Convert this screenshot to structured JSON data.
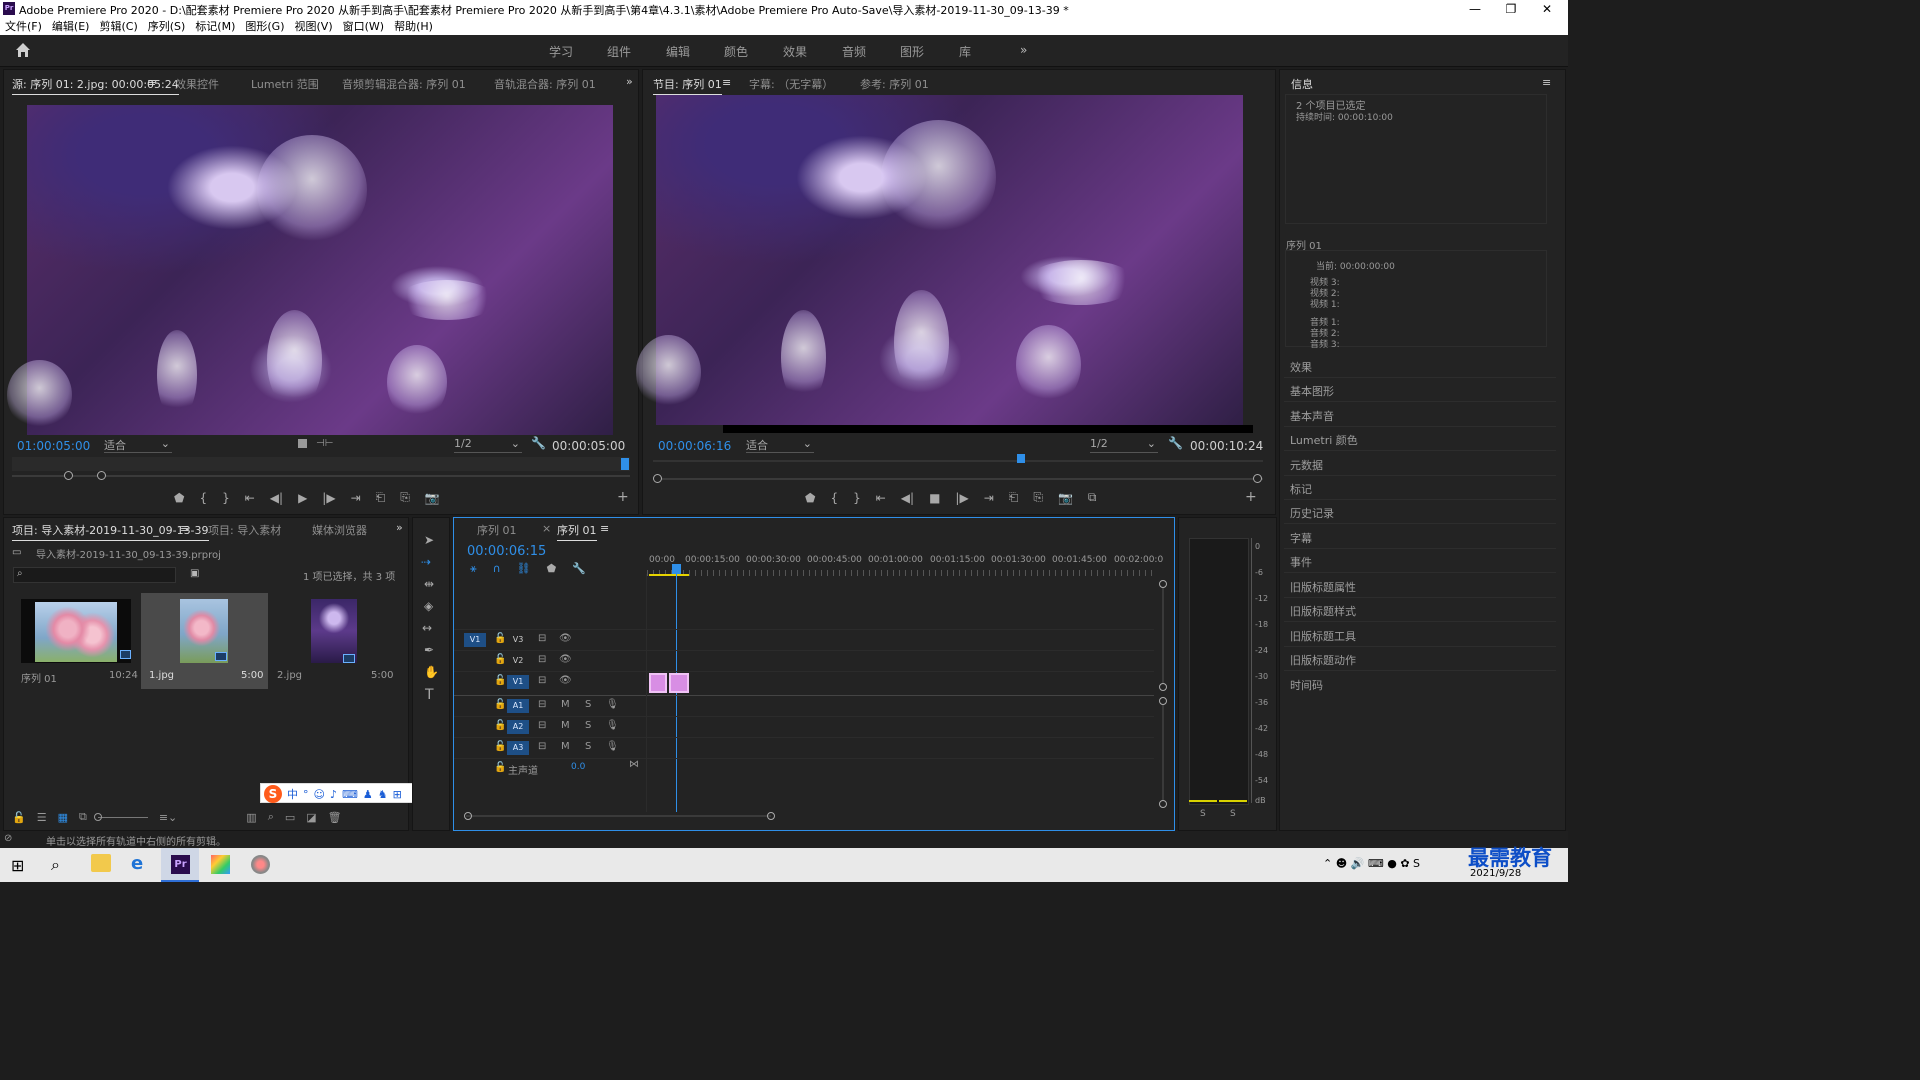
{
  "title_bar": {
    "app_badge": "Pr",
    "title": "Adobe Premiere Pro 2020 - D:\\配套素材 Premiere Pro 2020 从新手到高手\\配套素材 Premiere Pro 2020 从新手到高手\\第4章\\4.3.1\\素材\\Adobe Premiere Pro Auto-Save\\导入素材-2019-11-30_09-13-39 *",
    "min": "—",
    "max": "❐",
    "close": "✕"
  },
  "menu": [
    "文件(F)",
    "编辑(E)",
    "剪辑(C)",
    "序列(S)",
    "标记(M)",
    "图形(G)",
    "视图(V)",
    "窗口(W)",
    "帮助(H)"
  ],
  "workspaces": [
    "学习",
    "组件",
    "编辑",
    "颜色",
    "效果",
    "音频",
    "图形",
    "库"
  ],
  "source": {
    "tabs": [
      "源: 序列 01: 2.jpg: 00:00:05:24",
      "效果控件",
      "Lumetri 范围",
      "音频剪辑混合器: 序列 01",
      "音轨混合器: 序列 01"
    ],
    "timecode_in": "01:00:05:00",
    "fit": "适合",
    "res": "1/2",
    "timecode_dur": "00:00:05:00"
  },
  "program": {
    "tabs": [
      "节目: 序列 01",
      "字幕: （无字幕）",
      "参考: 序列 01"
    ],
    "timecode_in": "00:00:06:16",
    "fit": "适合",
    "res": "1/2",
    "timecode_dur": "00:00:10:24"
  },
  "project": {
    "tabs": [
      "项目: 导入素材-2019-11-30_09-13-39",
      "项目: 导入素材",
      "媒体浏览器"
    ],
    "file": "导入素材-2019-11-30_09-13-39.prproj",
    "selection": "1 项已选择，共 3 项",
    "items": [
      {
        "name": "序列 01",
        "dur": "10:24"
      },
      {
        "name": "1.jpg",
        "dur": "5:00"
      },
      {
        "name": "2.jpg",
        "dur": "5:00"
      }
    ]
  },
  "timeline": {
    "tabs": [
      "序列 01",
      "序列 01"
    ],
    "timecode": "00:00:06:15",
    "ruler": [
      "00:00",
      "00:00:15:00",
      "00:00:30:00",
      "00:00:45:00",
      "00:01:00:00",
      "00:01:15:00",
      "00:01:30:00",
      "00:01:45:00",
      "00:02:00:0"
    ],
    "video_tracks": [
      "V3",
      "V2",
      "V1"
    ],
    "audio_tracks": [
      "A1",
      "A2",
      "A3"
    ],
    "source_patch_v": "V1",
    "master": "主声道",
    "master_val": "0.0",
    "m": "M",
    "s": "S"
  },
  "meter": {
    "labels": [
      "0",
      "-6",
      "-12",
      "-18",
      "-24",
      "-30",
      "-36",
      "-42",
      "-48",
      "-54",
      "dB"
    ],
    "s1": "S",
    "s2": "S"
  },
  "info": {
    "title": "信息",
    "line1": "2 个项目已选定",
    "line2": "持续时间: 00:00:10:00",
    "seq": "序列 01",
    "current": "当前: 00:00:00:00",
    "vtracks": [
      "视频 3:",
      "视频 2:",
      "视频 1:"
    ],
    "atracks": [
      "音频 1:",
      "音频 2:",
      "音频 3:"
    ]
  },
  "right_panels": [
    "效果",
    "基本图形",
    "基本声音",
    "Lumetri 颜色",
    "元数据",
    "标记",
    "历史记录",
    "字幕",
    "事件",
    "旧版标题属性",
    "旧版标题样式",
    "旧版标题工具",
    "旧版标题动作",
    "时间码"
  ],
  "status": "单击以选择所有轨道中右侧的所有剪辑。",
  "taskbar": {
    "date": "2021/9/28",
    "watermark": "最需教育"
  }
}
